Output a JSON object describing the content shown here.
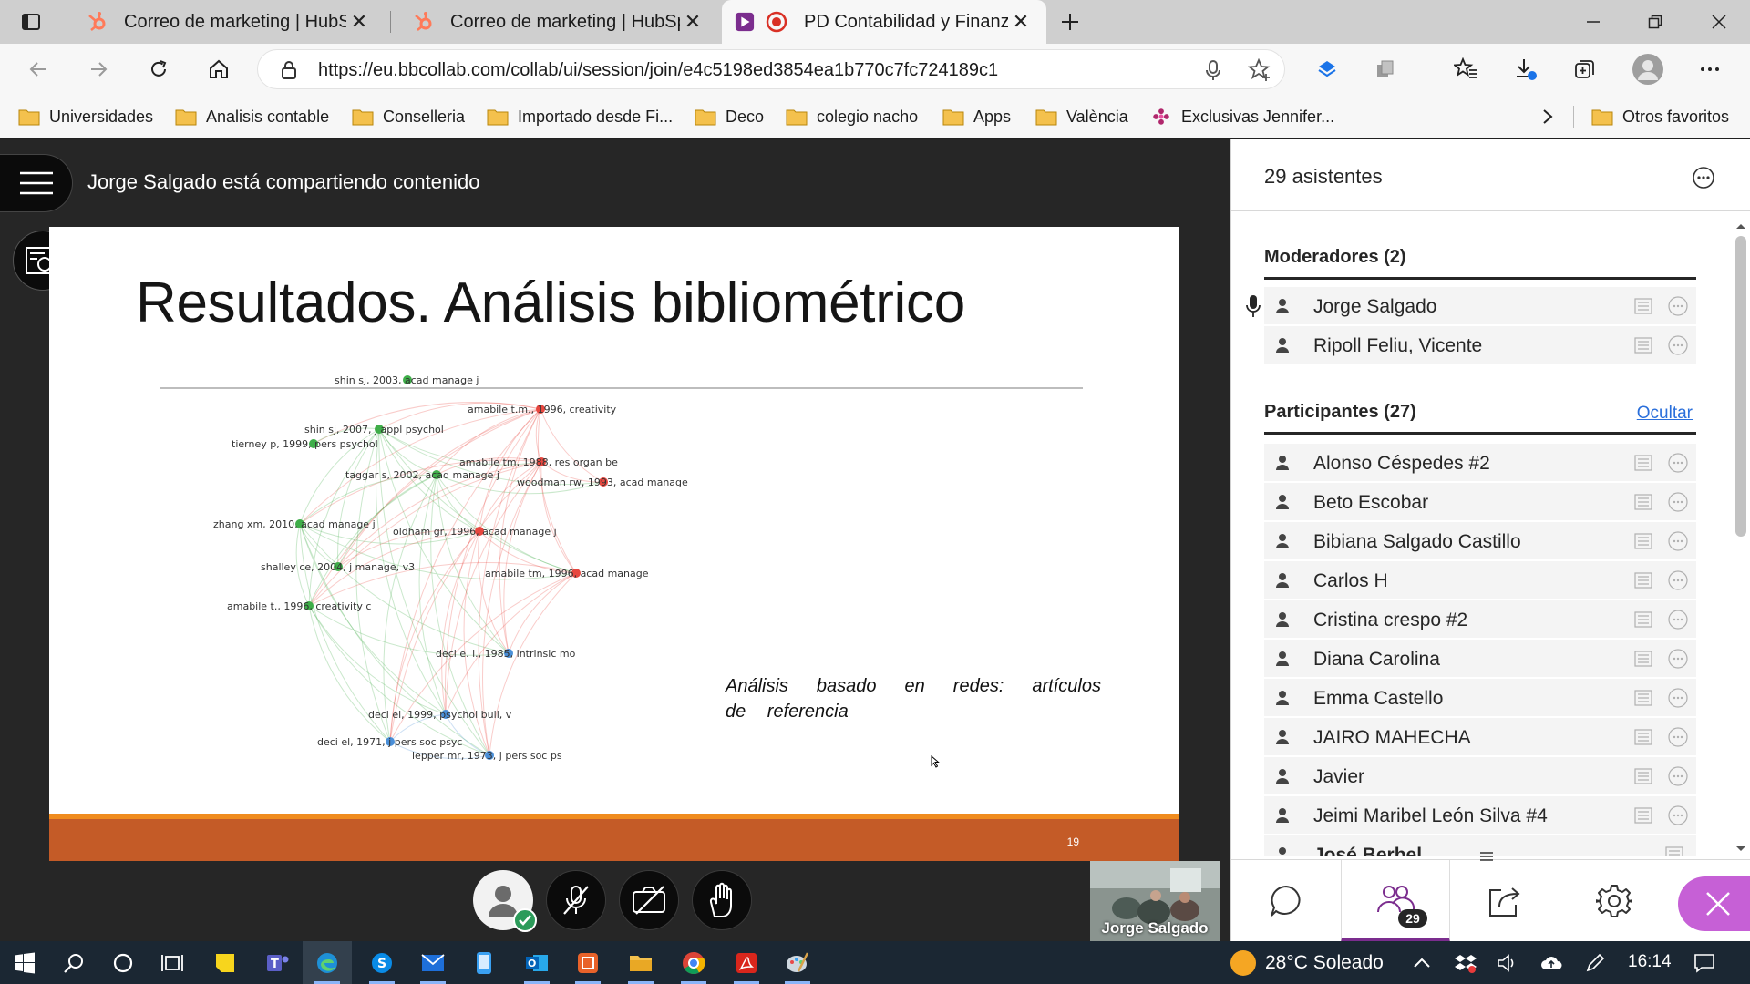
{
  "browser": {
    "tabs": [
      {
        "title": "Correo de marketing | HubSpot",
        "icon": "hubspot-icon",
        "active": false
      },
      {
        "title": "Correo de marketing | HubSpot",
        "icon": "hubspot-icon",
        "active": false
      },
      {
        "title": "PD Contabilidad y Finanzas",
        "icon": "recording-icon",
        "active": true
      }
    ],
    "url": "https://eu.bbcollab.com/collab/ui/session/join/e4c5198ed3854ea1b770c7fc724189c1",
    "favorites": [
      {
        "label": "Universidades"
      },
      {
        "label": "Analisis contable"
      },
      {
        "label": "Conselleria"
      },
      {
        "label": "Importado desde Fi..."
      },
      {
        "label": "Deco"
      },
      {
        "label": "colegio nacho"
      },
      {
        "label": "Apps"
      },
      {
        "label": "València"
      },
      {
        "label": "Exclusivas Jennifer..."
      }
    ],
    "other_favorites": "Otros favoritos",
    "accent_color": "#1a73e8"
  },
  "session": {
    "share_message": "Jorge Salgado está compartiendo contenido",
    "video_name": "Jorge Salgado",
    "slide": {
      "title": "Resultados. Análisis bibliométrico",
      "caption": "Análisis basado en redes: artículos de referencia",
      "page": "19",
      "footer_color": "#c45b27",
      "footer_stripe_color": "#f08c1e",
      "network_labels": [
        "shin sj, 2003, acad manage j",
        "amabile t.m., 1996, creativity",
        "shin sj, 2007, j appl psychol",
        "tierney p, 1999, pers psychol",
        "amabile tm, 1988, res organ be",
        "taggar s, 2002, acad manage j",
        "woodman rw, 1993, acad manage",
        "zhang xm, 2010, acad manage j",
        "oldham gr, 1996, acad manage j",
        "shalley ce, 2004, j manage, v3",
        "amabile tm, 1996, acad manage",
        "amabile t., 1996, creativity c",
        "deci e. l., 1985, intrinsic mo",
        "deci el, 1999, psychol bull, v",
        "deci el, 1971, j pers soc psyc",
        "lepper mr, 1973, j pers soc ps"
      ],
      "cluster_colors": {
        "green": "#3fae49",
        "red": "#e8473f",
        "blue": "#4a8fd8"
      }
    }
  },
  "panel": {
    "title": "29 asistentes",
    "moderators_heading": "Moderadores (2)",
    "moderators": [
      "Jorge Salgado",
      "Ripoll Feliu, Vicente"
    ],
    "participants_heading": "Participantes (27)",
    "hide_label": "Ocultar",
    "participants": [
      "Alonso Céspedes #2",
      "Beto Escobar",
      "Bibiana Salgado Castillo",
      "Carlos H",
      "Cristina crespo #2",
      "Diana Carolina",
      "Emma Castello",
      "JAIRO MAHECHA",
      "Javier",
      "Jeimi Maribel León Silva #4",
      "José Berbel"
    ],
    "attendee_count": "29",
    "accent_color": "#7b2d8e"
  },
  "taskbar": {
    "weather": "28°C  Soleado",
    "time": "16:14"
  }
}
